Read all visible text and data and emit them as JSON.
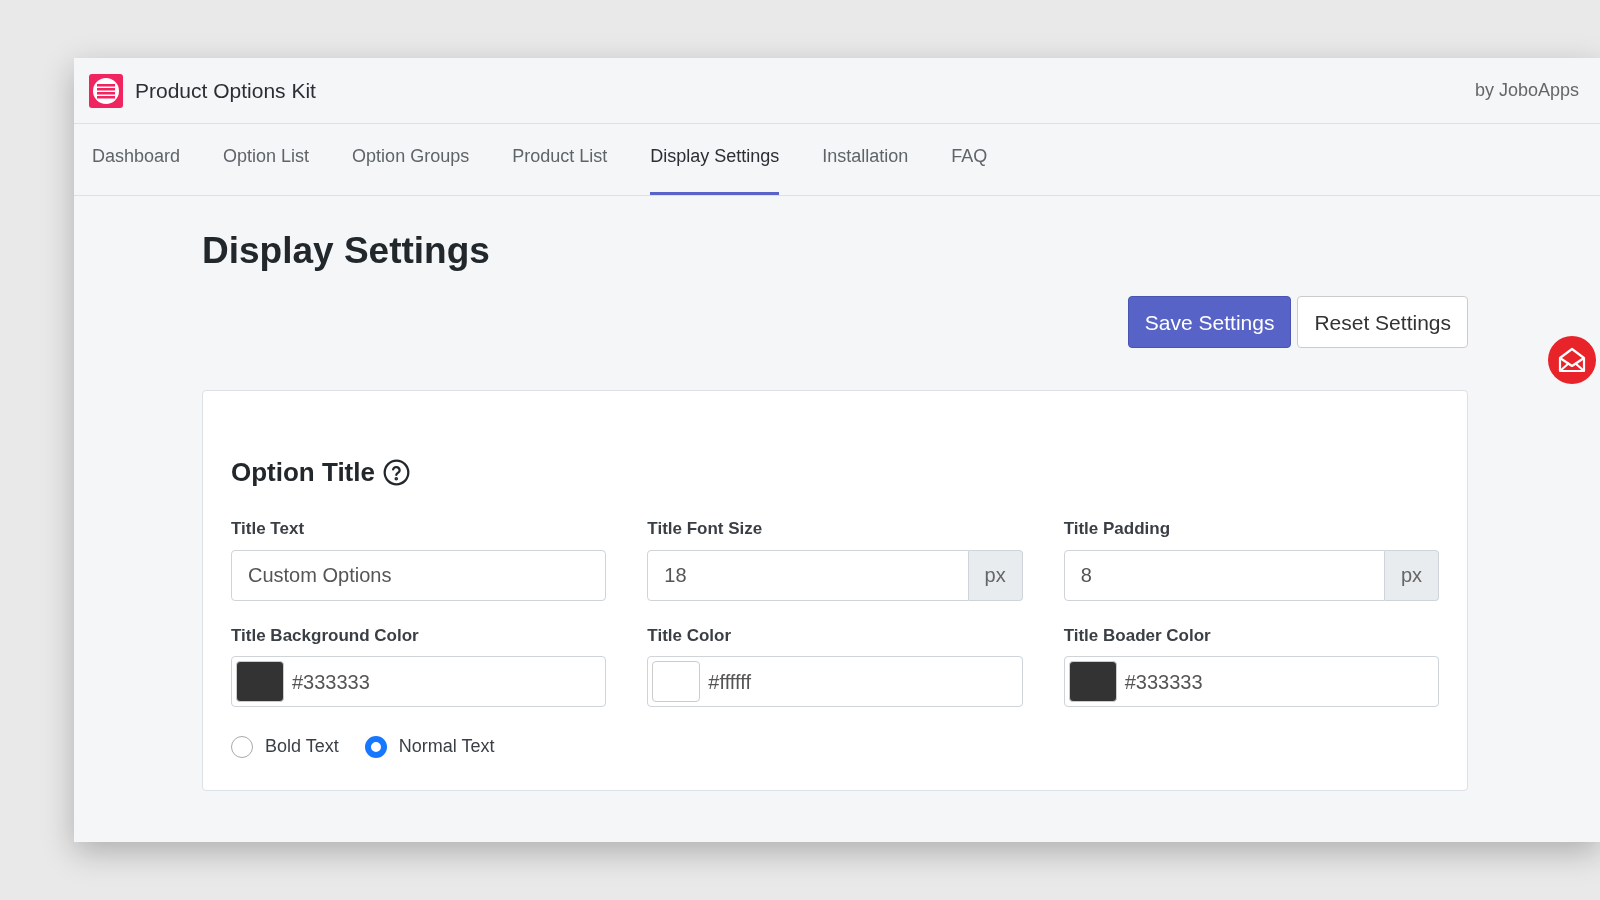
{
  "app": {
    "title": "Product Options Kit",
    "byline": "by JoboApps"
  },
  "tabs": [
    {
      "label": "Dashboard",
      "selected": false
    },
    {
      "label": "Option List",
      "selected": false
    },
    {
      "label": "Option Groups",
      "selected": false
    },
    {
      "label": "Product List",
      "selected": false
    },
    {
      "label": "Display Settings",
      "selected": true
    },
    {
      "label": "Installation",
      "selected": false
    },
    {
      "label": "FAQ",
      "selected": false
    }
  ],
  "page_title": "Display Settings",
  "actions": [
    {
      "label": "Save Settings",
      "kind": "primary"
    },
    {
      "label": "Reset Settings",
      "kind": "secondary"
    }
  ],
  "section": {
    "title": "Option Title",
    "fields": [
      {
        "kind": "text",
        "label": "Title Text",
        "value": "Custom Options"
      },
      {
        "kind": "unit",
        "label": "Title Font Size",
        "value": "18",
        "unit": "px"
      },
      {
        "kind": "unit",
        "label": "Title Padding",
        "value": "8",
        "unit": "px"
      },
      {
        "kind": "color",
        "label": "Title Background Color",
        "value": "#333333",
        "color": "#333333"
      },
      {
        "kind": "color",
        "label": "Title Color",
        "value": "#ffffff",
        "color": "#ffffff"
      },
      {
        "kind": "color",
        "label": "Title Boader Color",
        "value": "#333333",
        "color": "#333333"
      }
    ],
    "font_weight_options": [
      {
        "label": "Bold Text",
        "selected": false
      },
      {
        "label": "Normal Text",
        "selected": true
      }
    ]
  }
}
